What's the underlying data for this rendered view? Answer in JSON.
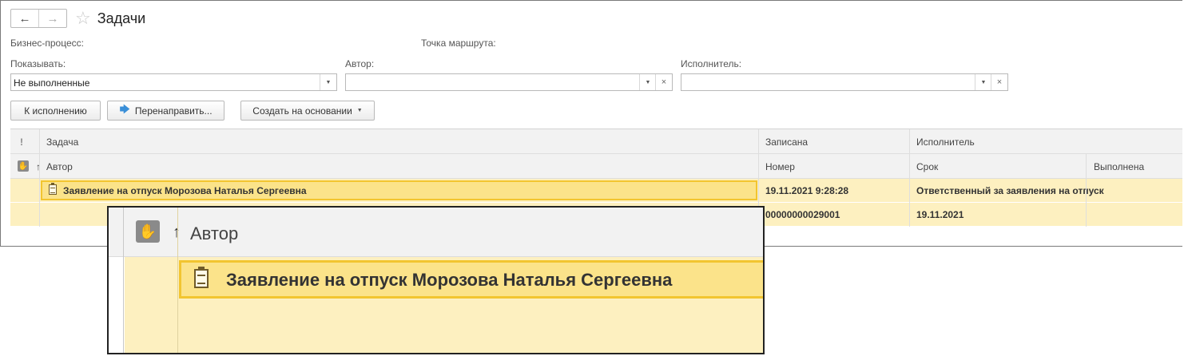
{
  "window": {
    "title": "Задачи",
    "back_icon": "←",
    "forward_icon": "→",
    "star_icon": "☆"
  },
  "filters": {
    "business_process_label": "Бизнес-процесс:",
    "route_point_label": "Точка маршрута:",
    "show_label": "Показывать:",
    "show_value": "Не выполненные",
    "author_label": "Автор:",
    "author_value": "",
    "executor_label": "Исполнитель:",
    "executor_value": "",
    "dropdown_glyph": "▼",
    "clear_glyph": "×"
  },
  "toolbar": {
    "execute_label": "К исполнению",
    "redirect_label": "Перенаправить...",
    "redirect_icon": "🡆",
    "create_based_label": "Создать на основании",
    "caret": "▼"
  },
  "table": {
    "importance_header": "!",
    "sort_arrow": "↑",
    "columns_row1": [
      "Задача",
      "Записана",
      "Исполнитель"
    ],
    "columns_row2": [
      "Автор",
      "Номер",
      "Срок",
      "Выполнена"
    ],
    "rows": [
      {
        "task": "Заявление на отпуск Морозова Наталья Сергеевна",
        "recorded": "19.11.2021 9:28:28",
        "executor": "Ответственный за заявления на отпуск",
        "author": "",
        "number": "00000000029001",
        "deadline": "19.11.2021",
        "completed": ""
      }
    ]
  },
  "zoom": {
    "header": "Автор",
    "sort_arrow": "↑",
    "task": "Заявление на отпуск Морозова Наталья Сергеевна"
  },
  "colors": {
    "row_bg": "#fdf0c0",
    "selected_bg": "#fbe38a",
    "selected_border": "#f2c530"
  }
}
